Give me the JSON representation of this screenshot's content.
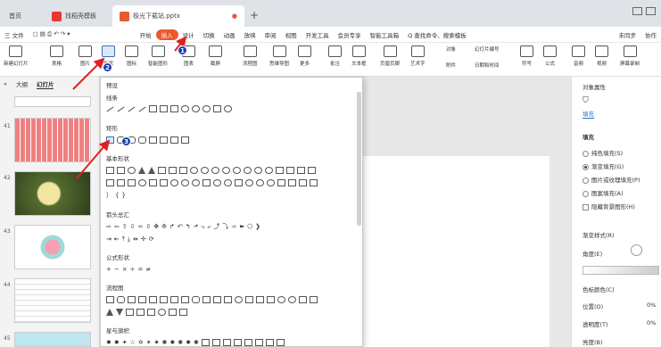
{
  "tabs": [
    {
      "label": "首页"
    },
    {
      "label": "找稻壳模板"
    },
    {
      "label": "极光下载站.pptx"
    }
  ],
  "menu": {
    "file": "三 文件",
    "items": [
      "开始",
      "插入",
      "设计",
      "切换",
      "动画",
      "放映",
      "审阅",
      "视图",
      "开发工具",
      "会员专享",
      "智能工具箱"
    ],
    "search": "Q 查找命令、搜索模板",
    "sync": "未同步",
    "collab": "协作"
  },
  "ribbon": [
    "新建幻灯片",
    "表格",
    "图片",
    "形状",
    "图标",
    "智能图形",
    "图表",
    "截屏",
    "流程图",
    "思维导图",
    "更多",
    "批注",
    "文本框",
    "页眉页脚",
    "艺术字",
    "附件",
    "日期和时间",
    "幻灯片编号",
    "对象",
    "符号",
    "公式",
    "音频",
    "视频",
    "屏幕录制"
  ],
  "sidebar": {
    "tab1": "大纲",
    "tab2": "幻灯片",
    "slides": [
      "41",
      "42",
      "43",
      "44",
      "45"
    ]
  },
  "dropdown": {
    "cats": [
      "预设",
      "线条",
      "矩形",
      "基本形状",
      "箭头总汇",
      "公式形状",
      "流程图",
      "星与旗帜"
    ]
  },
  "right": {
    "title": "对象属性",
    "subtab": "填充",
    "fill": "填充",
    "opts": [
      "纯色填充(S)",
      "渐变填充(G)",
      "图片或纹理填充(P)",
      "图案填充(A)"
    ],
    "hide": "隐藏背景图形(H)",
    "grad": "渐变样式(R)",
    "angle": "角度(E)",
    "stopcolor": "色标颜色(C)",
    "pos": "位置(O)",
    "trans": "透明度(T)",
    "bright": "亮度(B)",
    "pct": "0%"
  },
  "badges": [
    "1",
    "2",
    "3"
  ]
}
